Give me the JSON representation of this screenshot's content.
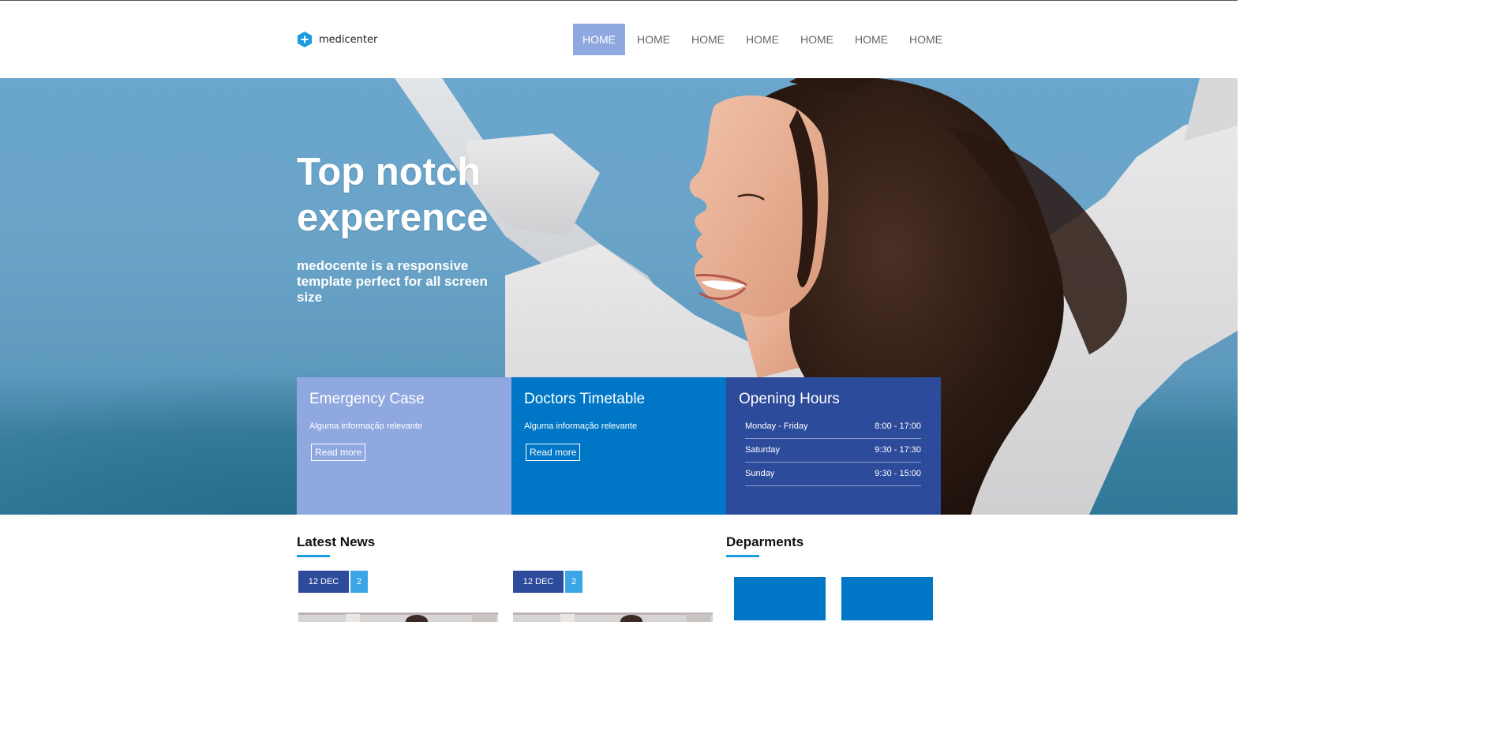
{
  "brand": {
    "name": "medicenter",
    "accent": "#0077c6",
    "icon": "hexagon-plus-icon"
  },
  "nav": {
    "items": [
      "HOME",
      "HOME",
      "HOME",
      "HOME",
      "HOME",
      "HOME",
      "HOME"
    ],
    "active_index": 0
  },
  "hero": {
    "title": "Top notch experence",
    "subtitle": "medocente is a responsive template perfect for all screen size"
  },
  "boxes": {
    "emergency": {
      "title": "Emergency Case",
      "text": "Alguma informação relevante",
      "button": "Read more",
      "color": "#90a8e0"
    },
    "timetable": {
      "title": "Doctors Timetable",
      "text": "Alguma informação relevante",
      "button": "Read more",
      "color": "#0077c6"
    },
    "hours": {
      "title": "Opening Hours",
      "color": "#2d4b9b",
      "rows": [
        {
          "day": "Monday - Friday",
          "time": "8:00 - 17:00"
        },
        {
          "day": "Saturday",
          "time": "9:30 - 17:30"
        },
        {
          "day": "Sunday",
          "time": "9:30 - 15:00"
        }
      ]
    }
  },
  "news": {
    "title": "Latest News",
    "items": [
      {
        "date": "12 DEC 12",
        "count": "2"
      },
      {
        "date": "12 DEC 12",
        "count": "2"
      }
    ]
  },
  "departments": {
    "title": "Deparments"
  }
}
